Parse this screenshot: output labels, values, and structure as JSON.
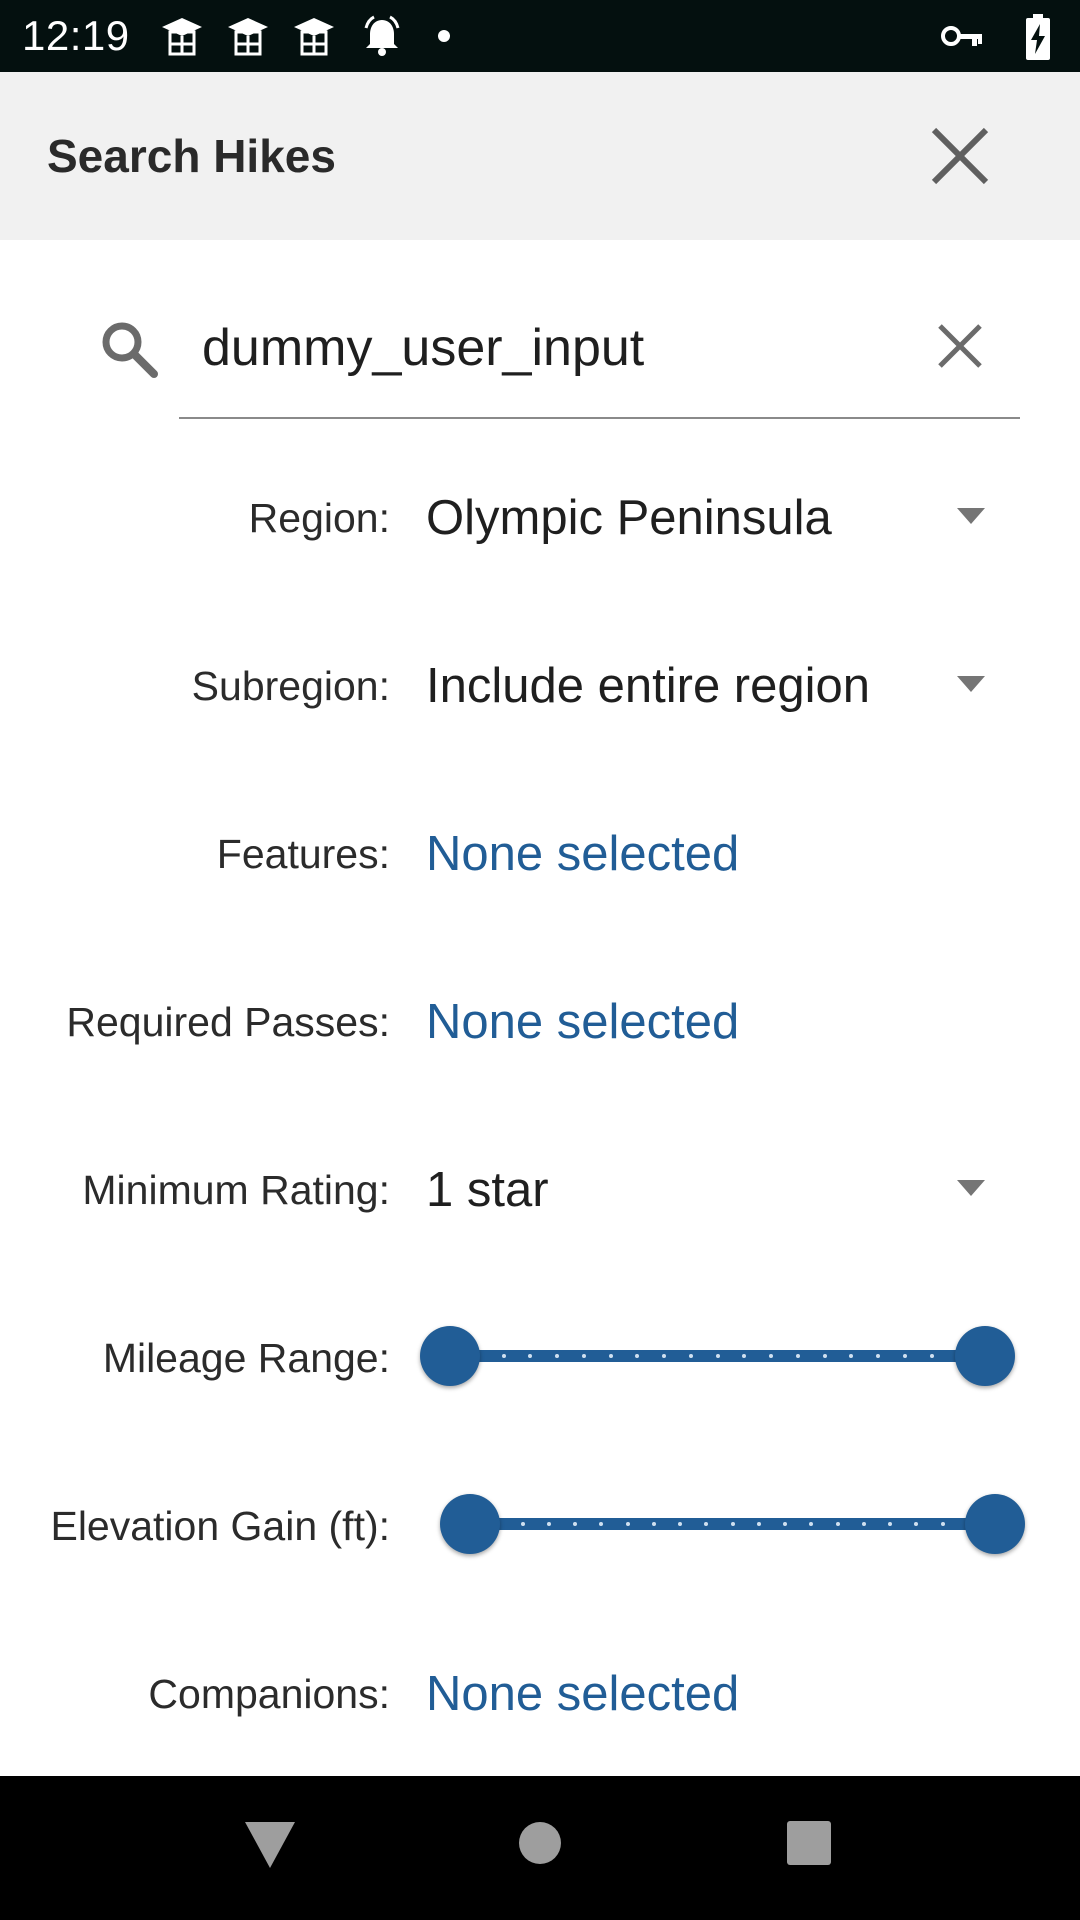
{
  "status_bar": {
    "time": "12:19",
    "icons": [
      "graduation-cap-icon",
      "graduation-cap-icon",
      "graduation-cap-icon",
      "alarm-bell-icon",
      "notification-dot-icon"
    ],
    "right_icons": [
      "vpn-key-icon",
      "battery-charging-icon"
    ]
  },
  "app_bar": {
    "title": "Search Hikes",
    "close_icon": "close-icon"
  },
  "search": {
    "value": "dummy_user_input",
    "icon": "search-icon",
    "clear_icon": "clear-icon"
  },
  "form": {
    "region": {
      "label": "Region:",
      "value": "Olympic Peninsula"
    },
    "subregion": {
      "label": "Subregion:",
      "value": "Include entire region"
    },
    "features": {
      "label": "Features:",
      "value": "None selected"
    },
    "required_passes": {
      "label": "Required Passes:",
      "value": "None selected"
    },
    "minimum_rating": {
      "label": "Minimum Rating:",
      "value": "1 star"
    },
    "mileage_range": {
      "label": "Mileage Range:",
      "min_fraction": 0.0,
      "max_fraction": 1.0
    },
    "elevation_gain": {
      "label": "Elevation Gain (ft):",
      "min_fraction": 0.0,
      "max_fraction": 1.0
    },
    "companions": {
      "label": "Companions:",
      "value": "None selected"
    }
  },
  "colors": {
    "accent": "#215d96",
    "status_bar_bg": "#04100f",
    "app_bar_bg": "#f1f1f1",
    "nav_bar_bg": "#000000"
  },
  "nav_bar": {
    "icons": [
      "back-triangle-icon",
      "home-circle-icon",
      "recents-square-icon"
    ]
  }
}
